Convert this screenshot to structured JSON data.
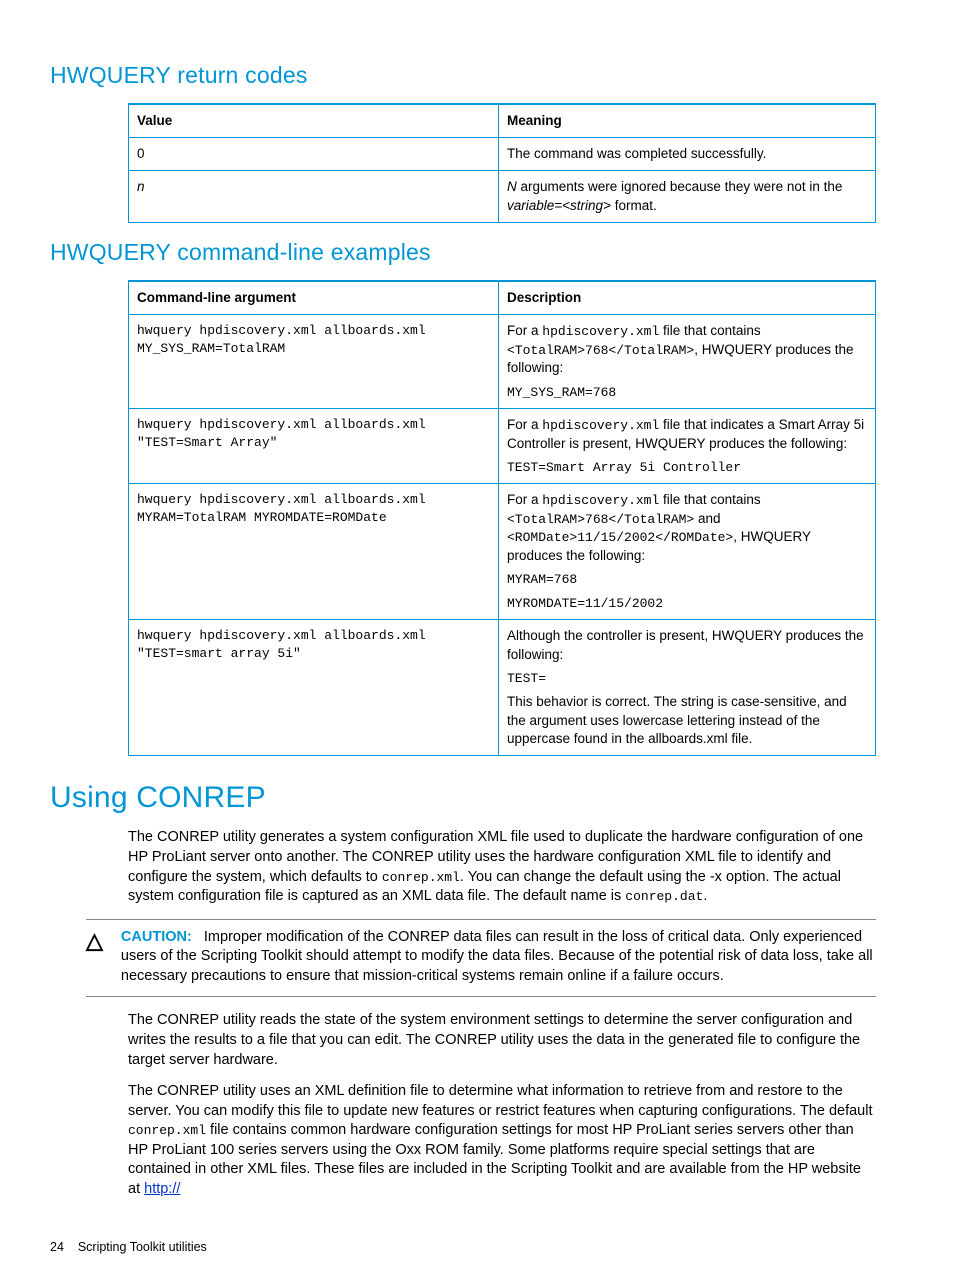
{
  "section1": {
    "heading": "HWQUERY return codes",
    "table": {
      "headers": [
        "Value",
        "Meaning"
      ],
      "rows": [
        {
          "value": "0",
          "meaning": "The command was completed successfully."
        },
        {
          "value_italic": "n",
          "meaning_pre": "N",
          "meaning_mid": " arguments were ignored because they were not in the ",
          "meaning_var": "variable=<string>",
          "meaning_post": " format."
        }
      ]
    }
  },
  "section2": {
    "heading": "HWQUERY command-line examples",
    "table": {
      "headers": [
        "Command-line argument",
        "Description"
      ],
      "rows": [
        {
          "arg": "hwquery hpdiscovery.xml allboards.xml MY_SYS_RAM=TotalRAM",
          "desc_pre": "For a ",
          "desc_code1": "hpdiscovery.xml",
          "desc_mid1": " file that contains ",
          "desc_code2": "<TotalRAM>768</TotalRAM>",
          "desc_post1": ", HWQUERY produces the following:",
          "out1": "MY_SYS_RAM=768"
        },
        {
          "arg": "hwquery hpdiscovery.xml allboards.xml \"TEST=Smart Array\"",
          "desc_pre": "For a ",
          "desc_code1": "hpdiscovery.xml",
          "desc_post1": " file that indicates a Smart Array 5i Controller is present, HWQUERY produces the following:",
          "out1": "TEST=Smart Array 5i Controller"
        },
        {
          "arg": "hwquery hpdiscovery.xml allboards.xml MYRAM=TotalRAM MYROMDATE=ROMDate",
          "desc_pre": "For a ",
          "desc_code1": "hpdiscovery.xml",
          "desc_mid1": " file that contains ",
          "desc_code2": "<TotalRAM>768</TotalRAM>",
          "desc_mid2": " and ",
          "desc_code3": "<ROMDate>11/15/2002</ROMDate>",
          "desc_post1": ", HWQUERY produces the following:",
          "out1": "MYRAM=768",
          "out2": "MYROMDATE=11/15/2002"
        },
        {
          "arg": "hwquery hpdiscovery.xml allboards.xml \"TEST=smart array 5i\"",
          "desc_pre": "Although the controller is present, HWQUERY produces the following:",
          "out1": "TEST=",
          "desc_post2": "This behavior is correct. The string is case-sensitive, and the argument uses lowercase lettering instead of the uppercase found in the allboards.xml file."
        }
      ]
    }
  },
  "section3": {
    "heading": "Using CONREP",
    "para1_a": "The CONREP utility generates a system configuration XML file used to duplicate the hardware configuration of one HP ProLiant server onto another. The CONREP utility uses the hardware configuration XML file to identify and configure the system, which defaults to ",
    "para1_code1": "conrep.xml",
    "para1_b": ". You can change the default using the -x option. The actual system configuration file is captured as an XML data file. The default name is ",
    "para1_code2": "conrep.dat",
    "para1_c": ".",
    "caution_label": "CAUTION:",
    "caution_text": "Improper modification of the CONREP data files can result in the loss of critical data. Only experienced users of the Scripting Toolkit should attempt to modify the data files. Because of the potential risk of data loss, take all necessary precautions to ensure that mission-critical systems remain online if a failure occurs.",
    "para2": "The CONREP utility reads the state of the system environment settings to determine the server configuration and writes the results to a file that you can edit. The CONREP utility uses the data in the generated file to configure the target server hardware.",
    "para3_a": "The CONREP utility uses an XML definition file to determine what information to retrieve from and restore to the server. You can modify this file to update new features or restrict features when capturing configurations. The default ",
    "para3_code": "conrep.xml",
    "para3_b": " file contains common hardware configuration settings for most HP ProLiant series servers other than HP ProLiant 100 series servers using the Oxx ROM family. Some platforms require special settings that are contained in other XML files. These files are included in the Scripting Toolkit and are available from the HP website at ",
    "para3_link": "http://"
  },
  "footer": {
    "page": "24",
    "title": "Scripting Toolkit utilities"
  },
  "icons": {
    "caution": "△"
  }
}
